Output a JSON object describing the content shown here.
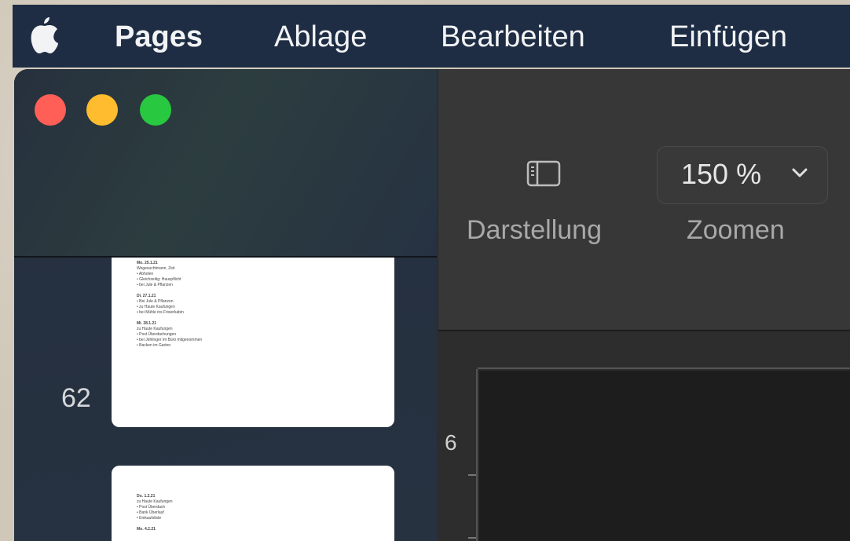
{
  "menubar": {
    "apple_icon": "apple-logo",
    "items": [
      "Pages",
      "Ablage",
      "Bearbeiten",
      "Einfügen"
    ]
  },
  "sidebar": {
    "page_number": "62",
    "thumb1_lines": [
      "Mo. 25.1.21",
      "Wegesuchtmann, Zeit",
      "• Abholen",
      "• Gleichzeitig: Hauspflicht",
      "• bei Jule & Pflanzen",
      "",
      "Di. 27.1.21",
      "• Bei Jule & Pflanzen",
      "• zu Haute Kaufungen",
      "• bei Mühle ins Frisierkabin",
      "",
      "Mi. 28.1.21",
      "zu Haute Kaufungen",
      "• Post Überdachungen",
      "• bei Jehlinger im Büro mitgenommen",
      "• Backen im Garten"
    ],
    "thumb2_lines": [
      "Do. 1.2.21",
      "zu Haute Kaufungen",
      "• Post Überdach",
      "• Bank Überlauf",
      "• Einkaufsliste",
      "",
      "Mo. 4.2.21"
    ]
  },
  "toolbar": {
    "view_label": "Darstellung",
    "view_icon": "sidebar-toggle-icon",
    "zoom_value": "150 %",
    "zoom_label": "Zoomen",
    "zoom_chevron": "chevron-down-icon"
  },
  "canvas": {
    "ruler_number": "6"
  },
  "colors": {
    "menubar": "#1e2d44",
    "close": "#ff5f57",
    "minimize": "#febc2e",
    "zoom": "#28c840"
  }
}
